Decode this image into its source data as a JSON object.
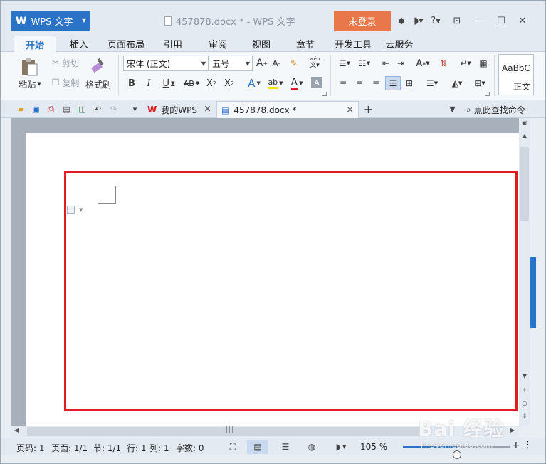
{
  "app": {
    "menu_label": "WPS 文字",
    "doc_title": "457878.docx * - WPS 文字",
    "login_label": "未登录"
  },
  "ribbon_tabs": [
    {
      "label": "开始",
      "active": true
    },
    {
      "label": "插入"
    },
    {
      "label": "页面布局"
    },
    {
      "label": "引用"
    },
    {
      "label": "审阅"
    },
    {
      "label": "视图"
    },
    {
      "label": "章节"
    },
    {
      "label": "开发工具"
    },
    {
      "label": "云服务"
    }
  ],
  "ribbon": {
    "paste_label": "粘贴",
    "cut_label": "剪切",
    "copy_label": "复制",
    "format_painter_label": "格式刷",
    "font_name": "宋体 (正文)",
    "font_size": "五号",
    "style_sample": "AaBbC",
    "style_name": "正文"
  },
  "doc_tabs": [
    {
      "label": "我的WPS"
    },
    {
      "label": "457878.docx *",
      "active": true
    }
  ],
  "search_label": "点此查找命令",
  "status": {
    "page_number": "页码: 1",
    "pages": "页面: 1/1",
    "section": "节: 1/1",
    "line": "行: 1",
    "column": "列: 1",
    "word_count": "字数: 0",
    "zoom": "105 %",
    "zoom_value": 105
  },
  "colors": {
    "accent": "#2b73c7",
    "login": "#e8784a",
    "highlight": "#e01b24"
  },
  "watermark": {
    "main": "Bai 经验",
    "sub": "jingyan.baidu.com"
  }
}
